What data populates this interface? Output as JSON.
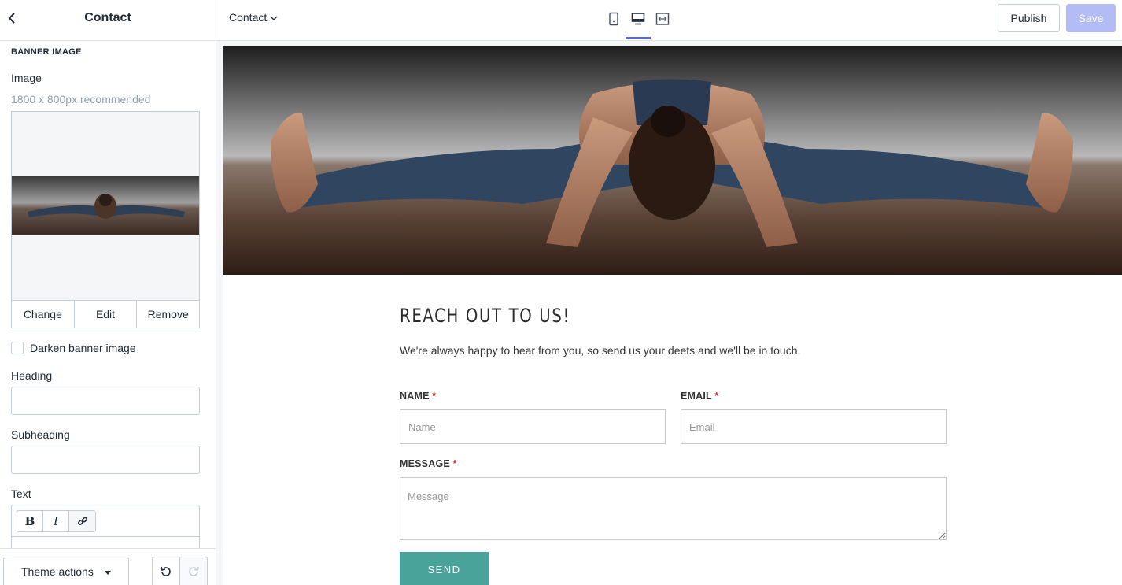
{
  "sidebar": {
    "title": "Contact",
    "section_title": "BANNER IMAGE",
    "image_label": "Image",
    "image_hint": "1800 x 800px recommended",
    "image_actions": [
      "Change",
      "Edit",
      "Remove"
    ],
    "darken_label": "Darken banner image",
    "heading_label": "Heading",
    "heading_value": "",
    "subheading_label": "Subheading",
    "subheading_value": "",
    "text_label": "Text",
    "rte_buttons": [
      "B",
      "I",
      "link-icon"
    ],
    "theme_actions_label": "Theme actions"
  },
  "topbar": {
    "page_select": "Contact",
    "views": [
      "mobile-icon",
      "desktop-icon",
      "fullwidth-icon"
    ],
    "active_view": "desktop",
    "publish_label": "Publish",
    "save_label": "Save",
    "accent": "#5c6ac4"
  },
  "preview": {
    "heading": "REACH OUT TO US!",
    "subtext": "We're always happy to hear from you, so send us your deets and we'll be in touch.",
    "name_label": "NAME",
    "email_label": "EMAIL",
    "message_label": "MESSAGE",
    "required_mark": "*",
    "name_placeholder": "Name",
    "email_placeholder": "Email",
    "message_placeholder": "Message",
    "send_label": "SEND",
    "button_color": "#4aa39a"
  }
}
